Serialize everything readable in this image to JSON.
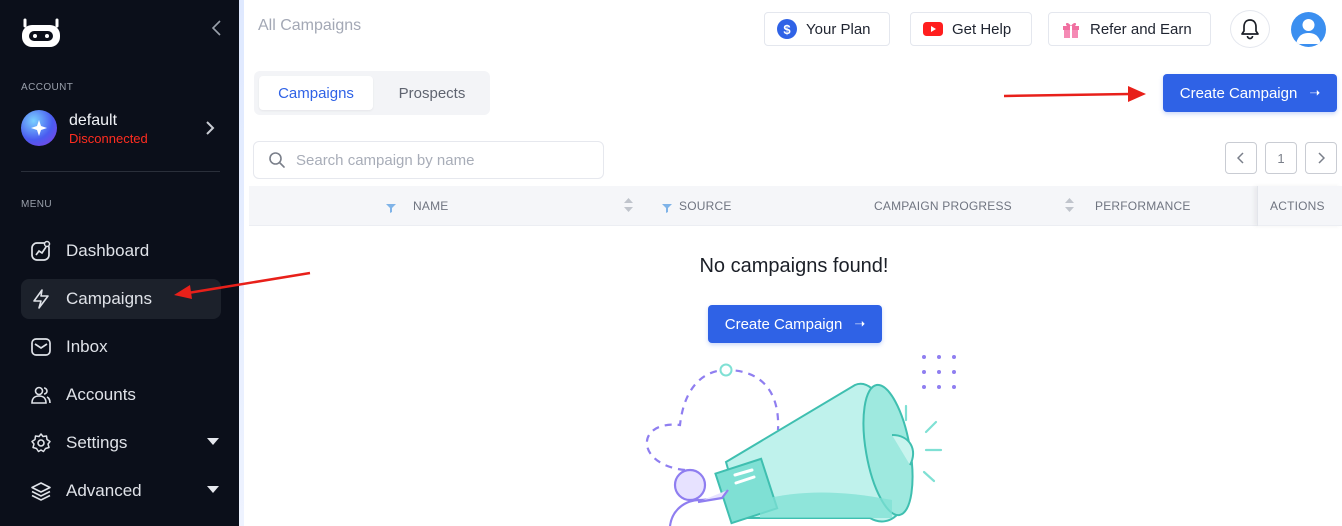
{
  "sidebar": {
    "account_section_label": "ACCOUNT",
    "account": {
      "name": "default",
      "status": "Disconnected"
    },
    "menu_section_label": "MENU",
    "items": [
      {
        "label": "Dashboard",
        "icon": "dashboard-icon"
      },
      {
        "label": "Campaigns",
        "icon": "lightning-icon",
        "active": true
      },
      {
        "label": "Inbox",
        "icon": "inbox-icon"
      },
      {
        "label": "Accounts",
        "icon": "users-icon"
      },
      {
        "label": "Settings",
        "icon": "gear-icon",
        "expandable": true
      },
      {
        "label": "Advanced",
        "icon": "layers-icon",
        "expandable": true
      }
    ]
  },
  "header": {
    "title": "All Campaigns",
    "your_plan": "Your Plan",
    "get_help": "Get Help",
    "refer_and_earn": "Refer and Earn"
  },
  "tabs": [
    {
      "label": "Campaigns",
      "active": true
    },
    {
      "label": "Prospects",
      "active": false
    }
  ],
  "create_campaign_label": "Create Campaign",
  "search": {
    "placeholder": "Search campaign by name",
    "value": ""
  },
  "pagination": {
    "current_page": "1"
  },
  "table": {
    "columns": [
      "NAME",
      "SOURCE",
      "CAMPAIGN PROGRESS",
      "PERFORMANCE",
      "ACTIONS"
    ]
  },
  "empty_state": {
    "title": "No campaigns found!",
    "button_label": "Create Campaign"
  },
  "colors": {
    "accent": "#2f62e6",
    "sidebar_bg": "#0b0f1a",
    "status_error": "#ff2d20",
    "annotation_arrow": "#e8201a",
    "illustration_teal": "#7fe0d4",
    "illustration_purple": "#8f7ef0"
  }
}
